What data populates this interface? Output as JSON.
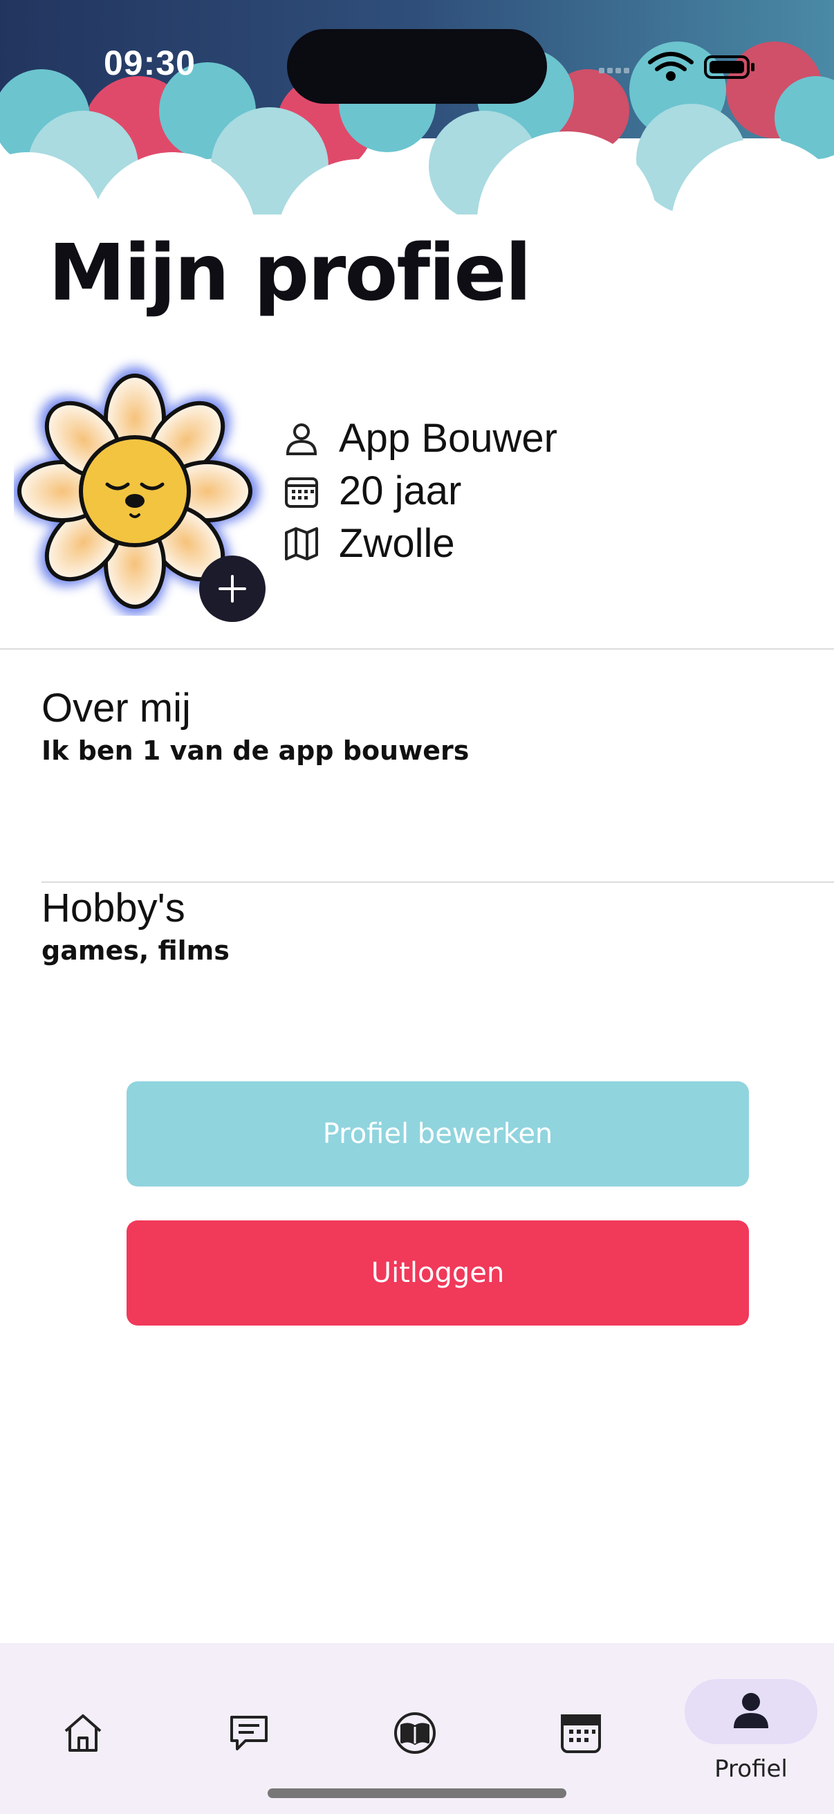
{
  "status_bar": {
    "time": "09:30"
  },
  "page": {
    "title": "Mijn profiel"
  },
  "profile": {
    "name": "App Bouwer",
    "age": "20 jaar",
    "city": "Zwolle",
    "avatar_icon": "flower-avatar-icon",
    "add_icon": "plus-icon"
  },
  "sections": {
    "about": {
      "title": "Over mij",
      "text": "Ik ben 1 van de app bouwers"
    },
    "hobbies": {
      "title": "Hobby's",
      "text": "games, films"
    }
  },
  "buttons": {
    "edit_label": "Profiel bewerken",
    "logout_label": "Uitloggen"
  },
  "tabbar": {
    "items": [
      {
        "icon": "home-icon"
      },
      {
        "icon": "chat-icon"
      },
      {
        "icon": "book-icon"
      },
      {
        "icon": "calendar-icon"
      },
      {
        "icon": "person-icon",
        "label": "Profiel",
        "active": true
      }
    ]
  },
  "colors": {
    "edit_button": "#90d4de",
    "logout_button": "#f1395a",
    "tabbar_bg": "#f3eef8",
    "active_pill": "#e6ddf7"
  }
}
